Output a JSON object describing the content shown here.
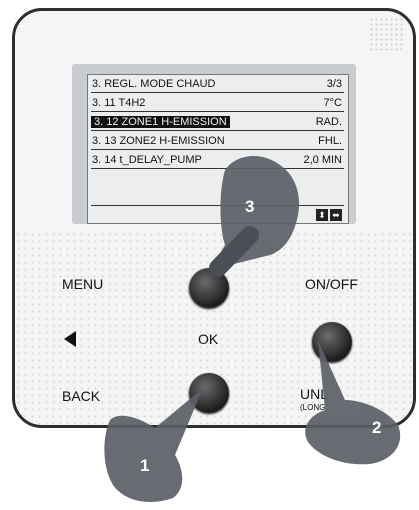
{
  "screen": {
    "title_row": {
      "label": "3. REGL. MODE CHAUD",
      "value": "3/3"
    },
    "rows": [
      {
        "label": "3. 11 T4H2",
        "value": "7°C"
      },
      {
        "label": "3. 12 ZONE1 H-EMISSION",
        "value": "RAD."
      },
      {
        "label": "3. 13 ZONE2 H-EMISSION",
        "value": "FHL."
      },
      {
        "label": "3. 14 t_DELAY_PUMP",
        "value": "2,0 MIN"
      }
    ]
  },
  "buttons": {
    "menu": "MENU",
    "on_off": "ON/OFF",
    "ok": "OK",
    "back": "BACK",
    "unlock": "UNL",
    "unlock_sub": "(LONG"
  },
  "steps": [
    "1",
    "2",
    "3"
  ]
}
